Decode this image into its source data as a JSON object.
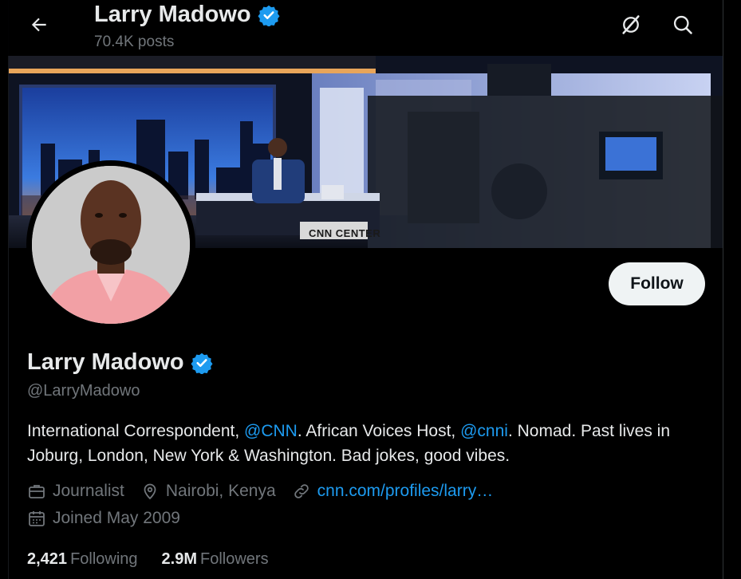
{
  "header": {
    "name": "Larry Madowo",
    "posts": "70.4K posts"
  },
  "profile": {
    "name": "Larry Madowo",
    "handle": "@LarryMadowo",
    "follow_label": "Follow",
    "bio": {
      "part1": "International Correspondent, ",
      "mention1": "@CNN",
      "part2": ". African Voices Host, ",
      "mention2": "@cnni",
      "part3": ". Nomad. Past lives in Joburg, London, New York & Washington. Bad jokes, good vibes."
    },
    "profession": "Journalist",
    "location": "Nairobi, Kenya",
    "website": "cnn.com/profiles/larry…",
    "joined": "Joined May 2009",
    "following_count": "2,421",
    "following_label": "Following",
    "followers_count": "2.9M",
    "followers_label": "Followers"
  },
  "banner": {
    "studio_sign": "CNN CENTER"
  },
  "colors": {
    "accent": "#1d9bf0",
    "background": "#000000",
    "text": "#e7e9ea",
    "muted": "#71767b"
  }
}
